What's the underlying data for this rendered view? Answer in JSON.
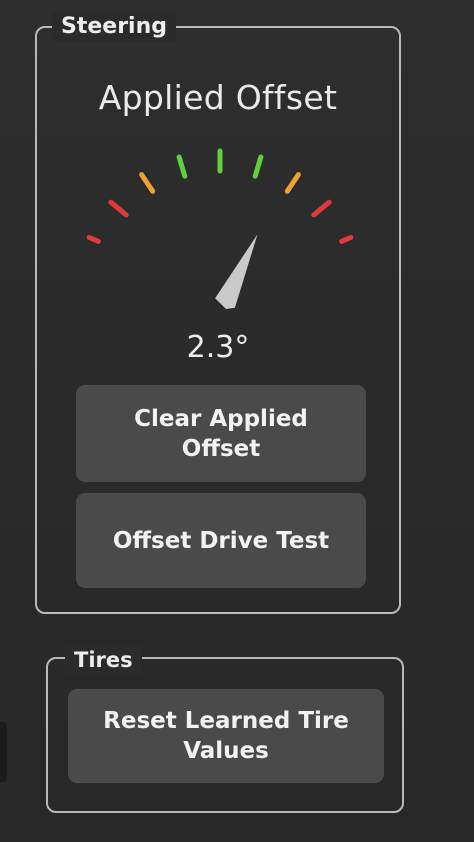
{
  "steering": {
    "section_label": "Steering",
    "gauge_title": "Applied Offset",
    "offset_value": "2.3°",
    "offset_degrees": 2.3,
    "clear_button": "Clear Applied Offset",
    "drive_test_button": "Offset Drive Test",
    "tick_colors": [
      "#e23a3a",
      "#e23a3a",
      "#f0a030",
      "#5fd13a",
      "#5fd13a",
      "#5fd13a",
      "#f0a030",
      "#e23a3a",
      "#e23a3a"
    ],
    "needle_color": "#c9c9c9"
  },
  "tires": {
    "section_label": "Tires",
    "reset_button": "Reset Learned Tire Values"
  }
}
